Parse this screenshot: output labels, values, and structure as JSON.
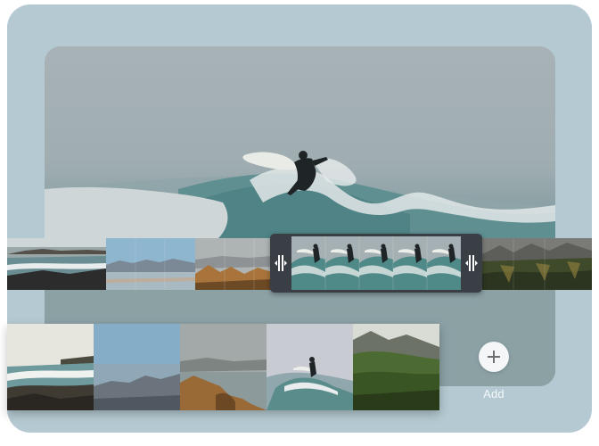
{
  "add": {
    "label": "Add",
    "icon": "plus-icon"
  },
  "colors": {
    "panel": "#b4c9d1",
    "selection_frame": "#3a3f45",
    "add_button": "#f4f6f7"
  }
}
